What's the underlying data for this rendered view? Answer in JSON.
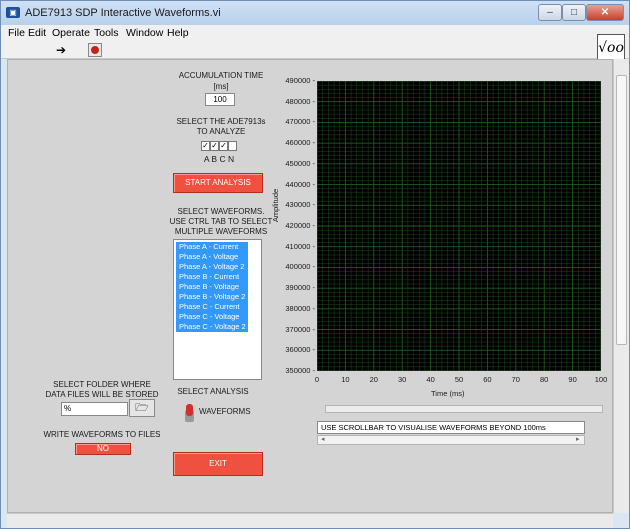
{
  "window": {
    "title": "ADE7913 SDP Interactive Waveforms.vi",
    "app_icon": "labview-icon"
  },
  "menu": [
    "File",
    "Edit",
    "Operate",
    "Tools",
    "Window",
    "Help"
  ],
  "toolbar": {
    "run": "run-arrow-icon",
    "abort": "abort-icon",
    "vi_icon_text": "√oo"
  },
  "accumulation": {
    "label1": "ACCUMULATION TIME",
    "label2": "[ms]",
    "value": "100"
  },
  "select_ade": {
    "label1": "SELECT THE ADE7913s",
    "label2": "TO ANALYZE",
    "checks": [
      "✓",
      "✓",
      "✓",
      ""
    ],
    "letters": "A B C N"
  },
  "start_button": "START ANALYSIS",
  "select_waveforms": {
    "label1": "SELECT WAVEFORMS.",
    "label2": "USE CTRL TAB TO SELECT",
    "label3": "MULTIPLE WAVEFORMS"
  },
  "waveforms": [
    "Phase A - Current",
    "Phase A - Voltage",
    "Phase A - Voltage 2",
    "Phase B - Current",
    "Phase B - Voltage",
    "Phase B - Voltage 2",
    "Phase C - Current",
    "Phase C - Voltage",
    "Phase C - Voltage 2"
  ],
  "folder": {
    "label1": "SELECT FOLDER WHERE",
    "label2": "DATA FILES WILL BE STORED",
    "path": "%"
  },
  "write": {
    "label": "WRITE WAVEFORMS TO FILES",
    "value": "NO"
  },
  "analysis": {
    "label": "SELECT ANALYSIS",
    "option": "WAVEFORMS"
  },
  "exit_button": "EXIT",
  "graph": {
    "ylabel": "Amplitude",
    "xlabel": "Time (ms)"
  },
  "note": "USE SCROLLBAR TO VISUALISE WAVEFORMS BEYOND 100ms",
  "chart_data": {
    "type": "line",
    "title": "",
    "xlabel": "Time (ms)",
    "ylabel": "Amplitude",
    "xlim": [
      0,
      100
    ],
    "ylim": [
      350000,
      490000
    ],
    "x_ticks": [
      0,
      10,
      20,
      30,
      40,
      50,
      60,
      70,
      80,
      90,
      100
    ],
    "y_ticks": [
      350000,
      360000,
      370000,
      380000,
      390000,
      400000,
      410000,
      420000,
      430000,
      440000,
      450000,
      460000,
      470000,
      480000,
      490000
    ],
    "grid": true,
    "background": "#000000",
    "grid_color": "#1f5a1f",
    "series": []
  }
}
